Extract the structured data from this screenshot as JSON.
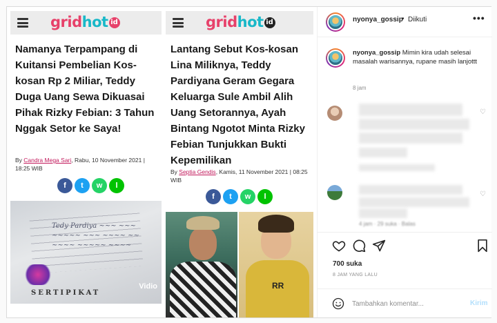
{
  "articles": [
    {
      "logo_a": "grid",
      "logo_b": "hot",
      "logo_id": "id",
      "headline": "Namanya Terpampang di Kuitansi Pembelian Kos-kosan Rp 2 Miliar, Teddy Duga Uang Sewa Dikuasai Pihak Rizky Febian: 3 Tahun Nggak Setor ke Saya!",
      "byline_prefix": "By ",
      "author": "Candra Mega Sari",
      "byline_date": ", Rabu, 10 November 2021 | 18:25 WIB",
      "share_icons": [
        "f",
        "t",
        "w",
        "l"
      ],
      "image_text": "SERTIPIKAT",
      "image_watermark": "Vidio"
    },
    {
      "logo_a": "grid",
      "logo_b": "hot",
      "logo_id": "id",
      "headline": "Lantang Sebut Kos-kosan Lina Miliknya, Teddy Pardiyana Geram Gegara Keluarga Sule Ambil Alih Uang Setorannya, Ayah Bintang Ngotot Minta Rizky Febian Tunjukkan Bukti Kepemilikan",
      "byline_prefix": "By ",
      "author": "Septia Gendis",
      "byline_date": ", Kamis, 11 November 2021 | 08:25 WIB",
      "share_icons": [
        "f",
        "t",
        "w",
        "l"
      ],
      "image_text": "RR"
    }
  ],
  "header": {
    "username": "nyonya_gossip",
    "separator": "•",
    "follow_status": "Diikuti",
    "more": "•••"
  },
  "caption": {
    "username": "nyonya_gossip",
    "text": " Mimin kira udah selesai masalah warisannya, rupane masih lanjottt",
    "time": "8 jam"
  },
  "comment2_meta": "4 jam · 29 suka · Balas",
  "likes": "700 suka",
  "posted": "8 JAM YANG LALU",
  "comment_box": {
    "placeholder": "Tambahkan komentar...",
    "submit": "Kirim"
  },
  "colors": {
    "accent_pink": "#e7416a",
    "accent_teal": "#19b8c8",
    "link_blue_disabled": "#b2dffc"
  }
}
